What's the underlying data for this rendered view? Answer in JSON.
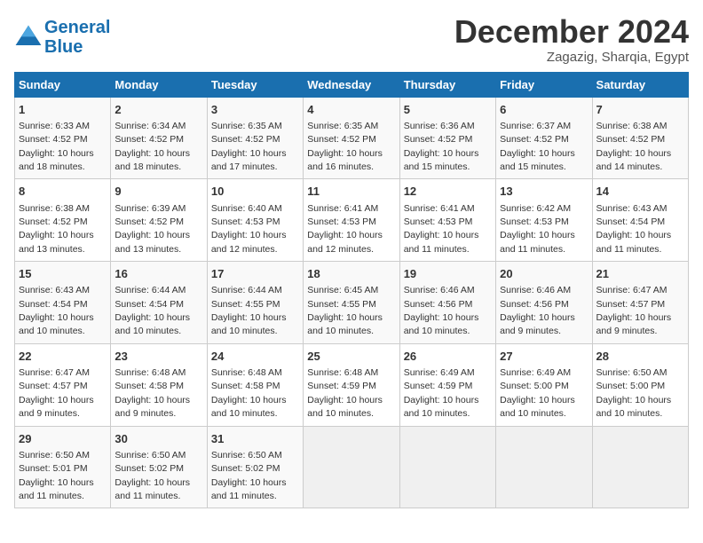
{
  "logo": {
    "text_general": "General",
    "text_blue": "Blue"
  },
  "title": "December 2024",
  "location": "Zagazig, Sharqia, Egypt",
  "days_of_week": [
    "Sunday",
    "Monday",
    "Tuesday",
    "Wednesday",
    "Thursday",
    "Friday",
    "Saturday"
  ],
  "weeks": [
    [
      {
        "day": "1",
        "sunrise": "6:33 AM",
        "sunset": "4:52 PM",
        "daylight": "10 hours and 18 minutes."
      },
      {
        "day": "2",
        "sunrise": "6:34 AM",
        "sunset": "4:52 PM",
        "daylight": "10 hours and 18 minutes."
      },
      {
        "day": "3",
        "sunrise": "6:35 AM",
        "sunset": "4:52 PM",
        "daylight": "10 hours and 17 minutes."
      },
      {
        "day": "4",
        "sunrise": "6:35 AM",
        "sunset": "4:52 PM",
        "daylight": "10 hours and 16 minutes."
      },
      {
        "day": "5",
        "sunrise": "6:36 AM",
        "sunset": "4:52 PM",
        "daylight": "10 hours and 15 minutes."
      },
      {
        "day": "6",
        "sunrise": "6:37 AM",
        "sunset": "4:52 PM",
        "daylight": "10 hours and 15 minutes."
      },
      {
        "day": "7",
        "sunrise": "6:38 AM",
        "sunset": "4:52 PM",
        "daylight": "10 hours and 14 minutes."
      }
    ],
    [
      {
        "day": "8",
        "sunrise": "6:38 AM",
        "sunset": "4:52 PM",
        "daylight": "10 hours and 13 minutes."
      },
      {
        "day": "9",
        "sunrise": "6:39 AM",
        "sunset": "4:52 PM",
        "daylight": "10 hours and 13 minutes."
      },
      {
        "day": "10",
        "sunrise": "6:40 AM",
        "sunset": "4:53 PM",
        "daylight": "10 hours and 12 minutes."
      },
      {
        "day": "11",
        "sunrise": "6:41 AM",
        "sunset": "4:53 PM",
        "daylight": "10 hours and 12 minutes."
      },
      {
        "day": "12",
        "sunrise": "6:41 AM",
        "sunset": "4:53 PM",
        "daylight": "10 hours and 11 minutes."
      },
      {
        "day": "13",
        "sunrise": "6:42 AM",
        "sunset": "4:53 PM",
        "daylight": "10 hours and 11 minutes."
      },
      {
        "day": "14",
        "sunrise": "6:43 AM",
        "sunset": "4:54 PM",
        "daylight": "10 hours and 11 minutes."
      }
    ],
    [
      {
        "day": "15",
        "sunrise": "6:43 AM",
        "sunset": "4:54 PM",
        "daylight": "10 hours and 10 minutes."
      },
      {
        "day": "16",
        "sunrise": "6:44 AM",
        "sunset": "4:54 PM",
        "daylight": "10 hours and 10 minutes."
      },
      {
        "day": "17",
        "sunrise": "6:44 AM",
        "sunset": "4:55 PM",
        "daylight": "10 hours and 10 minutes."
      },
      {
        "day": "18",
        "sunrise": "6:45 AM",
        "sunset": "4:55 PM",
        "daylight": "10 hours and 10 minutes."
      },
      {
        "day": "19",
        "sunrise": "6:46 AM",
        "sunset": "4:56 PM",
        "daylight": "10 hours and 10 minutes."
      },
      {
        "day": "20",
        "sunrise": "6:46 AM",
        "sunset": "4:56 PM",
        "daylight": "10 hours and 9 minutes."
      },
      {
        "day": "21",
        "sunrise": "6:47 AM",
        "sunset": "4:57 PM",
        "daylight": "10 hours and 9 minutes."
      }
    ],
    [
      {
        "day": "22",
        "sunrise": "6:47 AM",
        "sunset": "4:57 PM",
        "daylight": "10 hours and 9 minutes."
      },
      {
        "day": "23",
        "sunrise": "6:48 AM",
        "sunset": "4:58 PM",
        "daylight": "10 hours and 9 minutes."
      },
      {
        "day": "24",
        "sunrise": "6:48 AM",
        "sunset": "4:58 PM",
        "daylight": "10 hours and 10 minutes."
      },
      {
        "day": "25",
        "sunrise": "6:48 AM",
        "sunset": "4:59 PM",
        "daylight": "10 hours and 10 minutes."
      },
      {
        "day": "26",
        "sunrise": "6:49 AM",
        "sunset": "4:59 PM",
        "daylight": "10 hours and 10 minutes."
      },
      {
        "day": "27",
        "sunrise": "6:49 AM",
        "sunset": "5:00 PM",
        "daylight": "10 hours and 10 minutes."
      },
      {
        "day": "28",
        "sunrise": "6:50 AM",
        "sunset": "5:00 PM",
        "daylight": "10 hours and 10 minutes."
      }
    ],
    [
      {
        "day": "29",
        "sunrise": "6:50 AM",
        "sunset": "5:01 PM",
        "daylight": "10 hours and 11 minutes."
      },
      {
        "day": "30",
        "sunrise": "6:50 AM",
        "sunset": "5:02 PM",
        "daylight": "10 hours and 11 minutes."
      },
      {
        "day": "31",
        "sunrise": "6:50 AM",
        "sunset": "5:02 PM",
        "daylight": "10 hours and 11 minutes."
      },
      null,
      null,
      null,
      null
    ]
  ]
}
